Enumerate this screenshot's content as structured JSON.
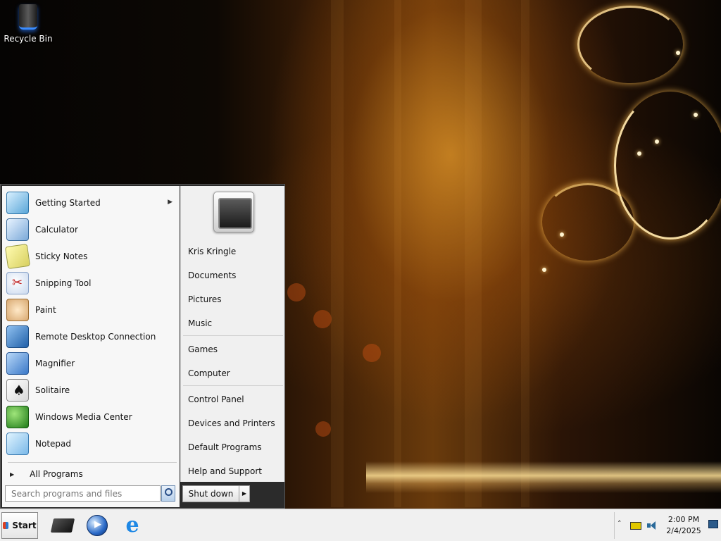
{
  "desktop": {
    "icons": [
      {
        "label": "Recycle Bin",
        "icon": "recycle-bin-icon"
      }
    ]
  },
  "start_menu": {
    "programs": [
      {
        "label": "Getting Started",
        "icon": "getting-started-icon",
        "has_submenu": true
      },
      {
        "label": "Calculator",
        "icon": "calculator-icon"
      },
      {
        "label": "Sticky Notes",
        "icon": "sticky-notes-icon"
      },
      {
        "label": "Snipping Tool",
        "icon": "snipping-tool-icon"
      },
      {
        "label": "Paint",
        "icon": "paint-icon"
      },
      {
        "label": "Remote Desktop Connection",
        "icon": "remote-desktop-icon"
      },
      {
        "label": "Magnifier",
        "icon": "magnifier-icon"
      },
      {
        "label": "Solitaire",
        "icon": "solitaire-icon"
      },
      {
        "label": "Windows Media Center",
        "icon": "media-center-icon"
      },
      {
        "label": "Notepad",
        "icon": "notepad-icon"
      }
    ],
    "all_programs_label": "All Programs",
    "search": {
      "placeholder": "Search programs and files"
    },
    "places": [
      {
        "label": "Kris Kringle"
      },
      {
        "label": "Documents"
      },
      {
        "label": "Pictures"
      },
      {
        "label": "Music"
      },
      {
        "label": "Games"
      },
      {
        "label": "Computer"
      },
      {
        "label": "Control Panel"
      },
      {
        "label": "Devices and Printers"
      },
      {
        "label": "Default Programs"
      },
      {
        "label": "Help and Support"
      }
    ],
    "shutdown_label": "Shut down"
  },
  "taskbar": {
    "start_label": "Start",
    "pinned": [
      {
        "icon": "windows-explorer-icon"
      },
      {
        "icon": "windows-media-player-icon"
      },
      {
        "icon": "internet-explorer-icon"
      }
    ],
    "tray": {
      "time": "2:00 PM",
      "date": "2/4/2025"
    }
  }
}
